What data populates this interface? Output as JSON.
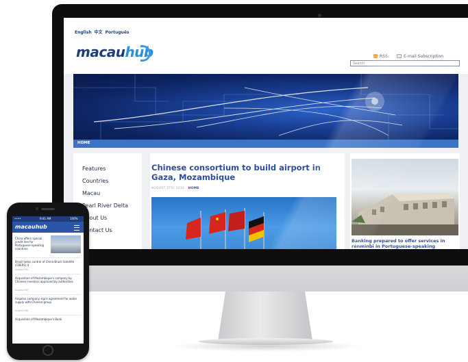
{
  "colors": {
    "brand_dark": "#1f3d7a",
    "brand_light": "#2f8fd6",
    "headline": "#2d4d9b",
    "nav": "#3b74c7"
  },
  "site": {
    "languages": [
      "English",
      "中文",
      "Português"
    ],
    "logo": {
      "part1": "macau",
      "part2": "hub"
    },
    "rss_label": "RSS",
    "email_label": "E-mail Subscription",
    "search_placeholder": "Search",
    "nav_home": "HOME",
    "sidebar": [
      "Features",
      "Countries",
      "Macau",
      "Pearl River Delta",
      "About Us",
      "Contact Us"
    ],
    "article": {
      "title": "Chinese consortium to build airport in Gaza, Mozambique",
      "date": "AUGUST 5TH, 2016",
      "category": "HOME"
    },
    "side_caption": "Banking prepared to offer services in renminbi in Portuguese-speaking"
  },
  "phone": {
    "status_time": "9:41 AM",
    "status_carrier": "•••• ",
    "status_battery": "100%",
    "logo": "macauhub",
    "feature_text": "China offers special credit line for Portuguese-speaking countries",
    "items": [
      {
        "title": "Brazil takes control of China-Brazil Satellite (CBERS) 4",
        "date": "August 5th"
      },
      {
        "title": "Acquisition of Mozambique's company by Chinese investors approved by authorities",
        "date": "August 5th"
      },
      {
        "title": "Angolan company signs agreement for water supply with Chinese group",
        "date": "August 5th"
      },
      {
        "title": "Acquisition of Mozambique's Bank",
        "date": ""
      }
    ]
  },
  "icons": [
    "rss-icon",
    "mail-icon",
    "menu-icon"
  ]
}
